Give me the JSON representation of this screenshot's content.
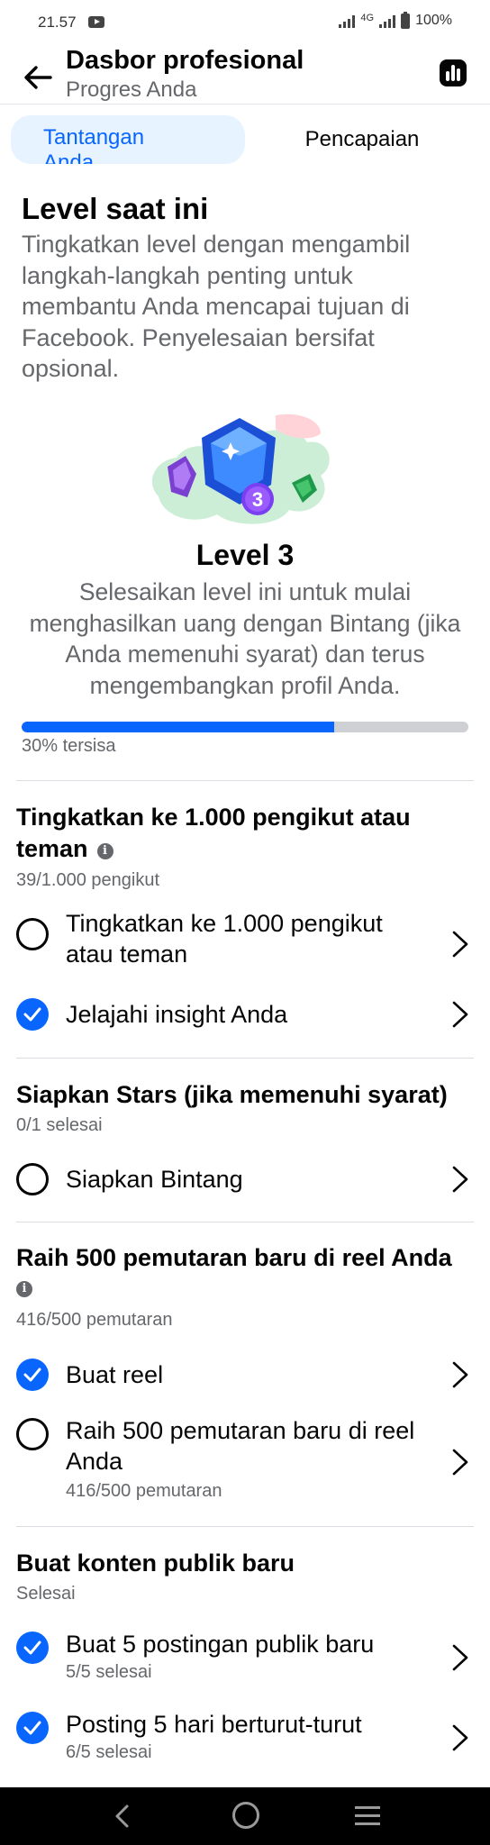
{
  "status_bar": {
    "time": "21.57",
    "network": "4G",
    "battery": "100%"
  },
  "header": {
    "title": "Dasbor profesional",
    "subtitle": "Progres Anda",
    "back_icon": "arrow-left-icon",
    "insights_icon": "bar-chart-icon"
  },
  "tabs": {
    "active": "Tantangan Anda",
    "inactive": "Pencapaian"
  },
  "level": {
    "heading": "Level saat ini",
    "description": "Tingkatkan level dengan mengambil langkah-langkah penting untuk membantu Anda mencapai tujuan di Facebook. Penyelesaian bersifat opsional.",
    "badge_number": "3",
    "title": "Level 3",
    "text": "Selesaikan level ini untuk mulai menghasilkan uang dengan Bintang (jika Anda memenuhi syarat) dan terus mengembangkan profil Anda.",
    "progress_percent": 70,
    "progress_label": "30% tersisa"
  },
  "sections": [
    {
      "title": "Tingkatkan ke 1.000 pengikut atau teman",
      "subtitle": "39/1.000 pengikut",
      "tasks": [
        {
          "label": "Tingkatkan ke 1.000 pengikut atau teman",
          "done": false
        },
        {
          "label": "Jelajahi insight Anda",
          "done": true
        }
      ]
    },
    {
      "title": "Siapkan Stars (jika memenuhi syarat)",
      "subtitle": "0/1 selesai",
      "tasks": [
        {
          "label": "Siapkan Bintang",
          "done": false
        }
      ]
    },
    {
      "title": "Raih 500 pemutaran baru di reel Anda",
      "subtitle": "416/500 pemutaran",
      "tasks": [
        {
          "label": "Buat reel",
          "done": true
        },
        {
          "label": "Raih 500 pemutaran baru di reel Anda",
          "sub": "416/500 pemutaran",
          "done": false
        }
      ]
    },
    {
      "title": "Buat konten publik baru",
      "subtitle": "Selesai",
      "tasks": [
        {
          "label": "Buat 5 postingan publik baru",
          "sub": "5/5 selesai",
          "done": true
        },
        {
          "label": "Posting 5 hari berturut-turut",
          "sub": "6/5 selesai",
          "done": true
        }
      ]
    }
  ],
  "colors": {
    "accent": "#0866ff",
    "tab_bg": "#e7f3ff",
    "secondary_text": "#65676b",
    "track": "#ced0d4"
  }
}
